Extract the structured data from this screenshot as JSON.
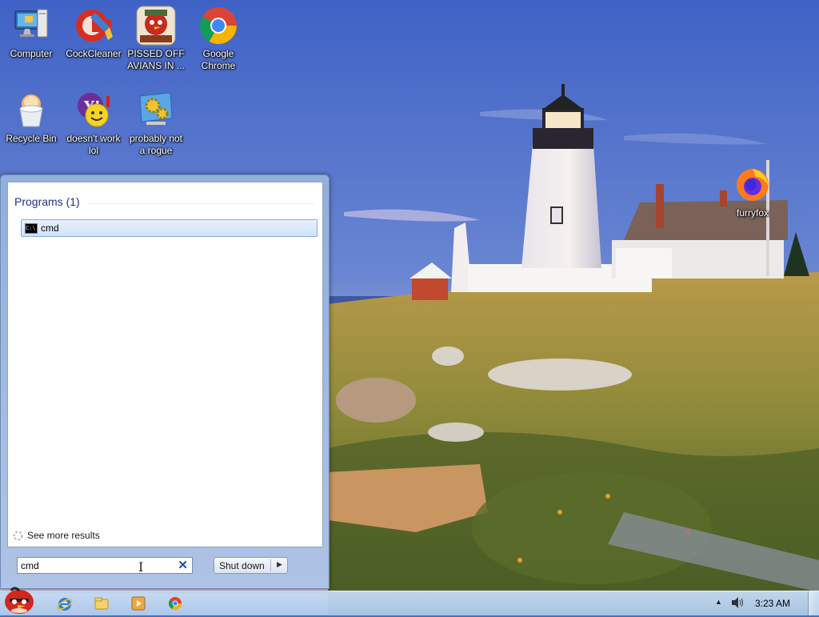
{
  "desktop": {
    "icons": [
      {
        "label": "Computer",
        "icon": "computer-icon"
      },
      {
        "label": "CockCleaner",
        "icon": "ccleaner-icon"
      },
      {
        "label": "PISSED OFF AVIANS IN ...",
        "icon": "angry-birds-seasons-icon"
      },
      {
        "label": "Google Chrome",
        "icon": "chrome-icon"
      },
      {
        "label": "Recycle Bin",
        "icon": "recycle-bin-icon"
      },
      {
        "label": "doesn't work lol",
        "icon": "yahoo-messenger-icon"
      },
      {
        "label": "probably not a rogue",
        "icon": "settings-gears-icon"
      },
      {
        "label": "furryfox",
        "icon": "firefox-icon"
      }
    ]
  },
  "start_menu": {
    "programs_header": "Programs (1)",
    "results": [
      {
        "label": "cmd",
        "icon": "command-prompt-icon"
      }
    ],
    "see_more": "See more results",
    "search": {
      "value": "cmd"
    },
    "shutdown_label": "Shut down"
  },
  "taskbar": {
    "pinned": [
      "internet-explorer-icon",
      "windows-explorer-icon",
      "media-player-icon",
      "chrome-icon"
    ],
    "clock": "3:23 AM"
  },
  "colors": {
    "sky": "#4a6ec0",
    "selection": "#cfe2fb",
    "header_text": "#1e3287",
    "taskbar": "#b4cbe8"
  }
}
